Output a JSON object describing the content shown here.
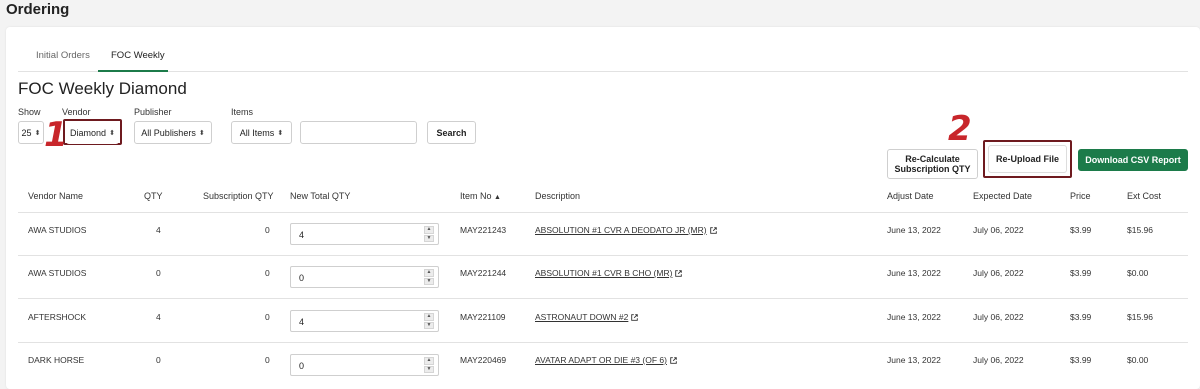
{
  "app": {
    "title": "Ordering"
  },
  "tabs": [
    {
      "label": "Initial Orders"
    },
    {
      "label": "FOC Weekly"
    }
  ],
  "heading": "FOC Weekly Diamond",
  "filters": {
    "show_label": "Show",
    "show_value": "25",
    "vendor_label": "Vendor",
    "vendor_value": "Diamond",
    "publisher_label": "Publisher",
    "publisher_value": "All Publishers",
    "items_label": "Items",
    "items_value": "All Items",
    "search_value": "",
    "search_button": "Search"
  },
  "annotations": {
    "one": "1",
    "two": "2"
  },
  "actions": {
    "recalc_line1": "Re-Calculate",
    "recalc_line2": "Subscription QTY",
    "reupload": "Re-Upload File",
    "download": "Download CSV Report"
  },
  "table": {
    "headers": {
      "vendor": "Vendor Name",
      "qty": "QTY",
      "sub_qty": "Subscription QTY",
      "new_total": "New Total QTY",
      "item_no": "Item No",
      "description": "Description",
      "adjust_date": "Adjust Date",
      "expected_date": "Expected Date",
      "price": "Price",
      "ext_cost": "Ext Cost"
    },
    "rows": [
      {
        "vendor": "AWA STUDIOS",
        "qty": "4",
        "sub_qty": "0",
        "new_total": "4",
        "item_no": "MAY221243",
        "description": "ABSOLUTION #1 CVR A DEODATO JR (MR)",
        "adjust_date": "June 13, 2022",
        "expected_date": "July 06, 2022",
        "price": "$3.99",
        "ext_cost": "$15.96"
      },
      {
        "vendor": "AWA STUDIOS",
        "qty": "0",
        "sub_qty": "0",
        "new_total": "0",
        "item_no": "MAY221244",
        "description": "ABSOLUTION #1 CVR B CHO (MR)",
        "adjust_date": "June 13, 2022",
        "expected_date": "July 06, 2022",
        "price": "$3.99",
        "ext_cost": "$0.00"
      },
      {
        "vendor": "AFTERSHOCK",
        "qty": "4",
        "sub_qty": "0",
        "new_total": "4",
        "item_no": "MAY221109",
        "description": "ASTRONAUT DOWN #2",
        "adjust_date": "June 13, 2022",
        "expected_date": "July 06, 2022",
        "price": "$3.99",
        "ext_cost": "$15.96"
      },
      {
        "vendor": "DARK HORSE",
        "qty": "0",
        "sub_qty": "0",
        "new_total": "0",
        "item_no": "MAY220469",
        "description": "AVATAR ADAPT OR DIE #3 (OF 6)",
        "adjust_date": "June 13, 2022",
        "expected_date": "July 06, 2022",
        "price": "$3.99",
        "ext_cost": "$0.00"
      }
    ]
  },
  "colors": {
    "accent": "#1c7b4a",
    "annotation_red": "#c8262b",
    "highlight_border": "#6e1a1f"
  }
}
